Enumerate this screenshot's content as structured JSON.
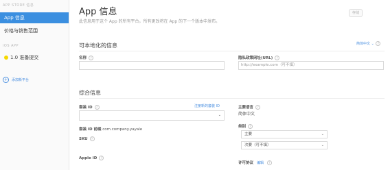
{
  "sidebar": {
    "section_top": "APP STORE 信息",
    "app_info": "App 信息",
    "pricing": "价格与销售范围",
    "section_ios": "iOS APP",
    "version": "1.0 准备提交",
    "add_platform": "添加新平台"
  },
  "header": {
    "title": "App 信息",
    "subtitle": "此信息用于这个 App 的所有平台。所有更改将在 App 的下一个版本中发布。",
    "save": "存储"
  },
  "localizable": {
    "title": "可本地化的信息",
    "language": "简体中文",
    "name_label": "名称",
    "name_value": "",
    "privacy_label": "隐私政策网址(URL)",
    "privacy_placeholder": "http://example.com（可不填）"
  },
  "general": {
    "title": "综合信息",
    "bundle_label": "套装 ID",
    "bundle_register": "注册新的套装 ID",
    "bundle_value": "",
    "bundle_prefix_label": "套装 ID 前缀",
    "bundle_prefix_value": "com.company.yayale",
    "sku_label": "SKU",
    "apple_id_label": "Apple ID",
    "primary_lang_label": "主要语言",
    "primary_lang_value": "简体中文",
    "category_label": "类别",
    "category_primary": "主要",
    "category_secondary": "次要（可不填）",
    "license_label": "许可协议",
    "license_edit": "编辑"
  }
}
